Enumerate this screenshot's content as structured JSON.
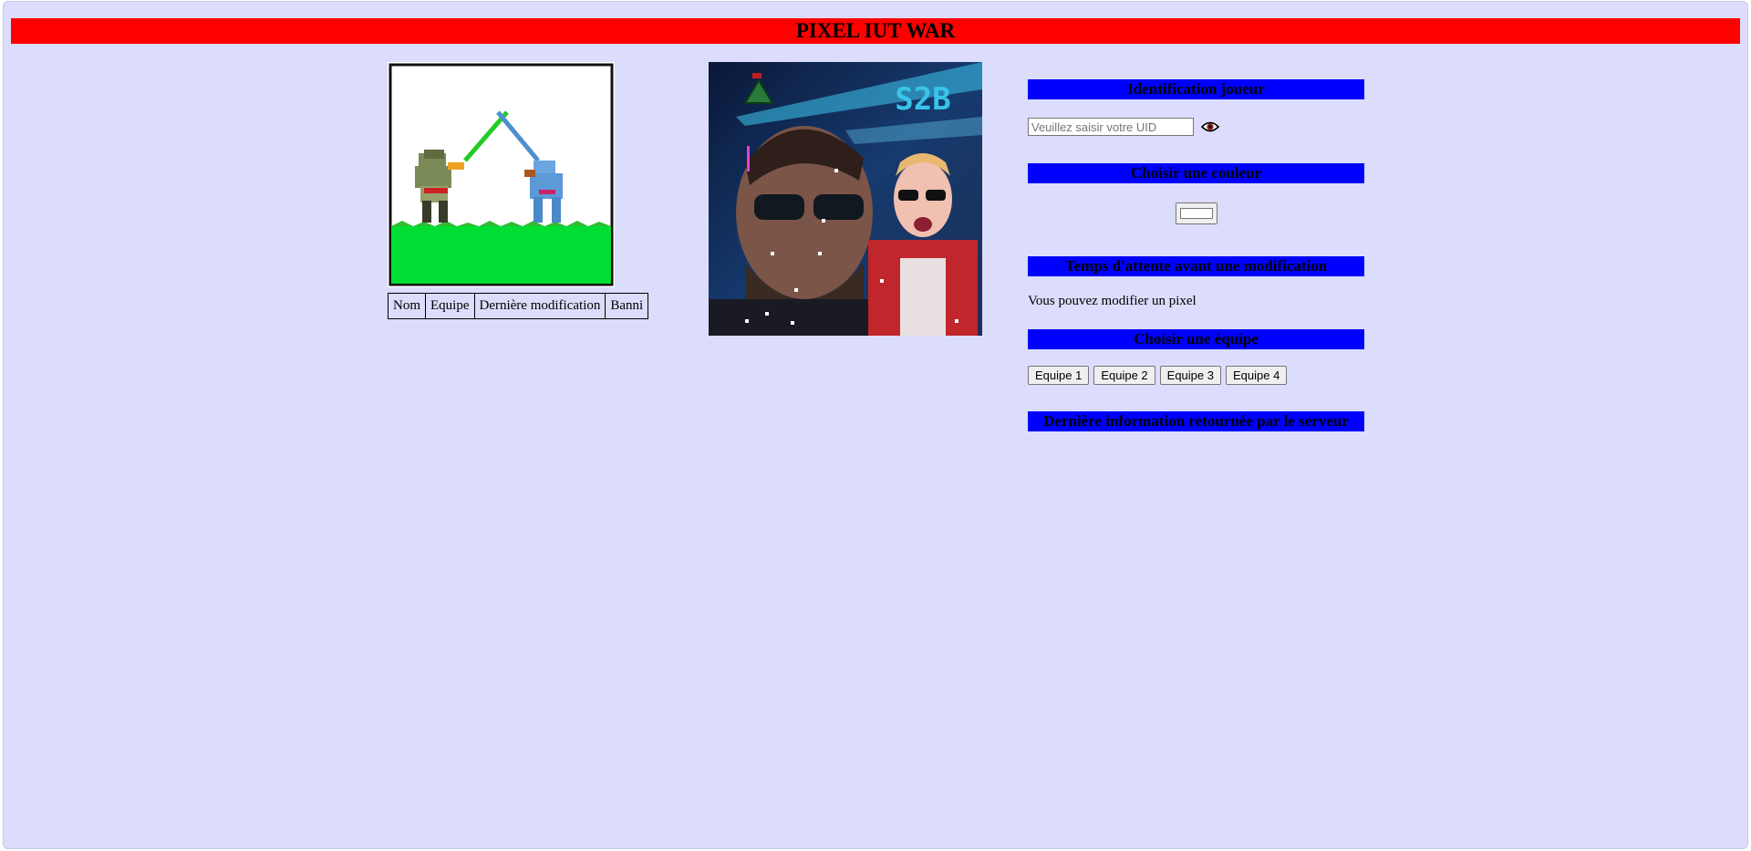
{
  "header": {
    "title": "PIXEL IUT WAR"
  },
  "players_table": {
    "columns": [
      "Nom",
      "Equipe",
      "Dernière modification",
      "Banni"
    ]
  },
  "sidebar": {
    "identification": {
      "heading": "Identification joueur",
      "uid_placeholder": "Veuillez saisir votre UID",
      "uid_value": "",
      "toggle_icon": "eye-icon"
    },
    "color": {
      "heading": "Choisir une couleur",
      "selected_color": "#ffffff"
    },
    "cooldown": {
      "heading": "Temps d'attente avant une modification",
      "status": "Vous pouvez modifier un pixel"
    },
    "teams": {
      "heading": "Choisir une équipe",
      "buttons": [
        "Equipe 1",
        "Equipe 2",
        "Equipe 3",
        "Equipe 4"
      ]
    },
    "server": {
      "heading": "Dernière information retournée par le serveur",
      "message": ""
    }
  },
  "canvas": {
    "text": "S2B"
  },
  "colors": {
    "banner": "#ff0000",
    "section_header": "#0000ff",
    "page_background": "#dcdcfc"
  }
}
